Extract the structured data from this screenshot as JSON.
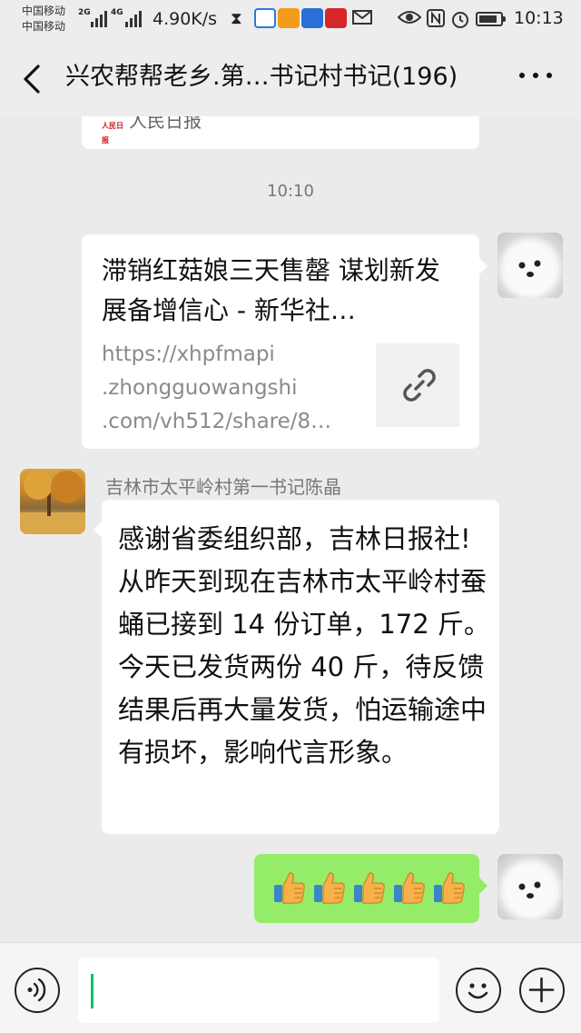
{
  "status_bar": {
    "carrier_1": "中国移动",
    "carrier_2": "中国移动",
    "net_1": "2G",
    "net_2": "4G",
    "speed": "4.90K/s",
    "time": "10:13",
    "battery_level": 0.85,
    "icons": [
      "hourglass-icon",
      "app-icon",
      "app-icon",
      "app-icon",
      "app-icon",
      "mail-icon",
      "eye-icon",
      "nfc-icon",
      "alarm-icon",
      "battery-icon"
    ]
  },
  "nav": {
    "title": "兴农帮帮老乡.第…书记村书记(196)",
    "back_icon": "chevron-left-icon",
    "more_icon": "more-dots-icon"
  },
  "chat": {
    "prev_card_source": "人民日报",
    "prev_card_logo": "人民日报",
    "time_label": "10:10",
    "link_card": {
      "title": "滞销红菇娘三天售罄 谋划新发展备增信心 - 新华社…",
      "url_lines": [
        "https://xhpfmapi",
        ".zhongguowangshi",
        ".com/vh512/share/8…"
      ],
      "thumb_icon": "link-icon"
    },
    "message": {
      "sender": "吉林市太平岭村第一书记陈晶",
      "text": "感谢省委组织部，吉林日报社!从昨天到现在吉林市太平岭村蚕蛹已接到 14 份订单，172 斤。今天已发货两份 40 斤，待反馈结果后再大量发货，怕运输途中有损坏，影响代言形象。"
    },
    "own_message": {
      "emoji": "👍👍👍👍👍",
      "count": 5
    }
  },
  "input_bar": {
    "voice_icon": "voice-icon",
    "emoji_icon": "emoji-icon",
    "plus_icon": "plus-icon",
    "value": ""
  },
  "colors": {
    "background": "#ebebeb",
    "own_bubble": "#95ec69",
    "caret": "#07c160"
  }
}
